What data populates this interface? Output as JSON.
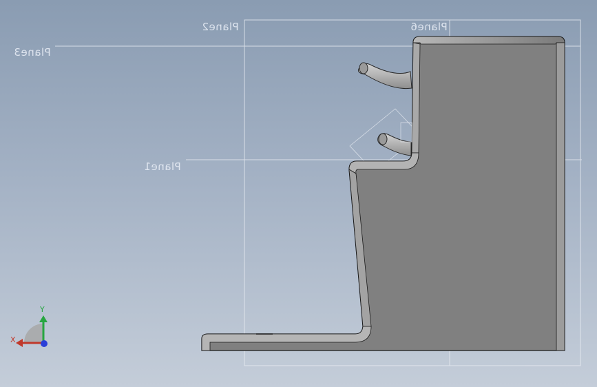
{
  "planes": {
    "plane1": "Plane1",
    "plane2": "Plane2",
    "plane3": "Plane3",
    "plane6": "Plane6"
  },
  "triad": {
    "x_label": "X",
    "y_label": "Y",
    "x_color": "#c0392b",
    "y_color": "#27a640",
    "z_color": "#2a3fd8"
  },
  "colors": {
    "background_top": "#8a9cb2",
    "background_bottom": "#c4cdd9",
    "part_face": "#808080",
    "part_edge": "#1a1a1a",
    "plane_line": "#e8ecf2"
  }
}
